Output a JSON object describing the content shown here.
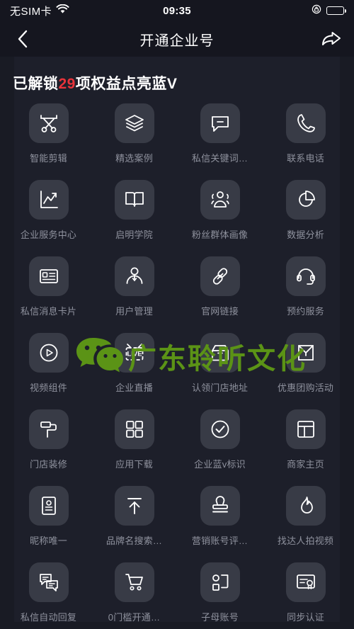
{
  "status_bar": {
    "carrier": "无SIM卡",
    "wifi_icon": "wifi-icon",
    "time": "09:35",
    "rotation_lock_icon": "rotation-lock-icon",
    "battery_icon": "battery-icon"
  },
  "nav_bar": {
    "back_icon": "back-chevron-icon",
    "title": "开通企业号",
    "share_icon": "share-arrow-icon"
  },
  "headline": {
    "prefix": "已解锁",
    "count": "29",
    "suffix": "项权益点亮蓝V",
    "count_color": "#e8333a"
  },
  "watermark": {
    "logo_icon": "wechat-logo-icon",
    "text": "广东聆听文化",
    "color": "#5b9316"
  },
  "theme": {
    "page_bg": "#191b24",
    "bar_bg": "#15161f",
    "panel_bg": "#1d1f2a",
    "tile_bg": "#383b46",
    "label_color": "#8f929e",
    "icon_color": "#ffffff"
  },
  "grid": {
    "items": [
      {
        "label": "智能剪辑",
        "icon": "scissors-icon"
      },
      {
        "label": "精选案例",
        "icon": "layers-icon"
      },
      {
        "label": "私信关键词…",
        "icon": "chat-bubble-minus-icon"
      },
      {
        "label": "联系电话",
        "icon": "phone-icon"
      },
      {
        "label": "企业服务中心",
        "icon": "line-chart-icon"
      },
      {
        "label": "启明学院",
        "icon": "open-book-icon"
      },
      {
        "label": "粉丝群体画像",
        "icon": "people-group-icon"
      },
      {
        "label": "数据分析",
        "icon": "pie-chart-icon"
      },
      {
        "label": "私信消息卡片",
        "icon": "id-card-icon"
      },
      {
        "label": "用户管理",
        "icon": "user-icon"
      },
      {
        "label": "官网链接",
        "icon": "link-icon"
      },
      {
        "label": "预约服务",
        "icon": "headset-icon"
      },
      {
        "label": "视频组件",
        "icon": "play-circle-icon"
      },
      {
        "label": "企业直播",
        "icon": "live-tv-icon"
      },
      {
        "label": "认领门店地址",
        "icon": "storefront-icon"
      },
      {
        "label": "优惠团购活动",
        "icon": "coupon-envelope-icon"
      },
      {
        "label": "门店装修",
        "icon": "paint-roller-icon"
      },
      {
        "label": "应用下载",
        "icon": "grid-squares-icon"
      },
      {
        "label": "企业蓝v标识",
        "icon": "check-circle-icon"
      },
      {
        "label": "商家主页",
        "icon": "layout-page-icon"
      },
      {
        "label": "昵称唯一",
        "icon": "id-badge-icon"
      },
      {
        "label": "品牌名搜索…",
        "icon": "arrow-up-bar-icon"
      },
      {
        "label": "营销账号评…",
        "icon": "stamp-icon"
      },
      {
        "label": "找达人拍视频",
        "icon": "flame-icon"
      },
      {
        "label": "私信自动回复",
        "icon": "chat-bubbles-icon"
      },
      {
        "label": "0门槛开通…",
        "icon": "shopping-cart-icon"
      },
      {
        "label": "子母账号",
        "icon": "sub-account-icon"
      },
      {
        "label": "同步认证",
        "icon": "certificate-icon"
      }
    ]
  }
}
